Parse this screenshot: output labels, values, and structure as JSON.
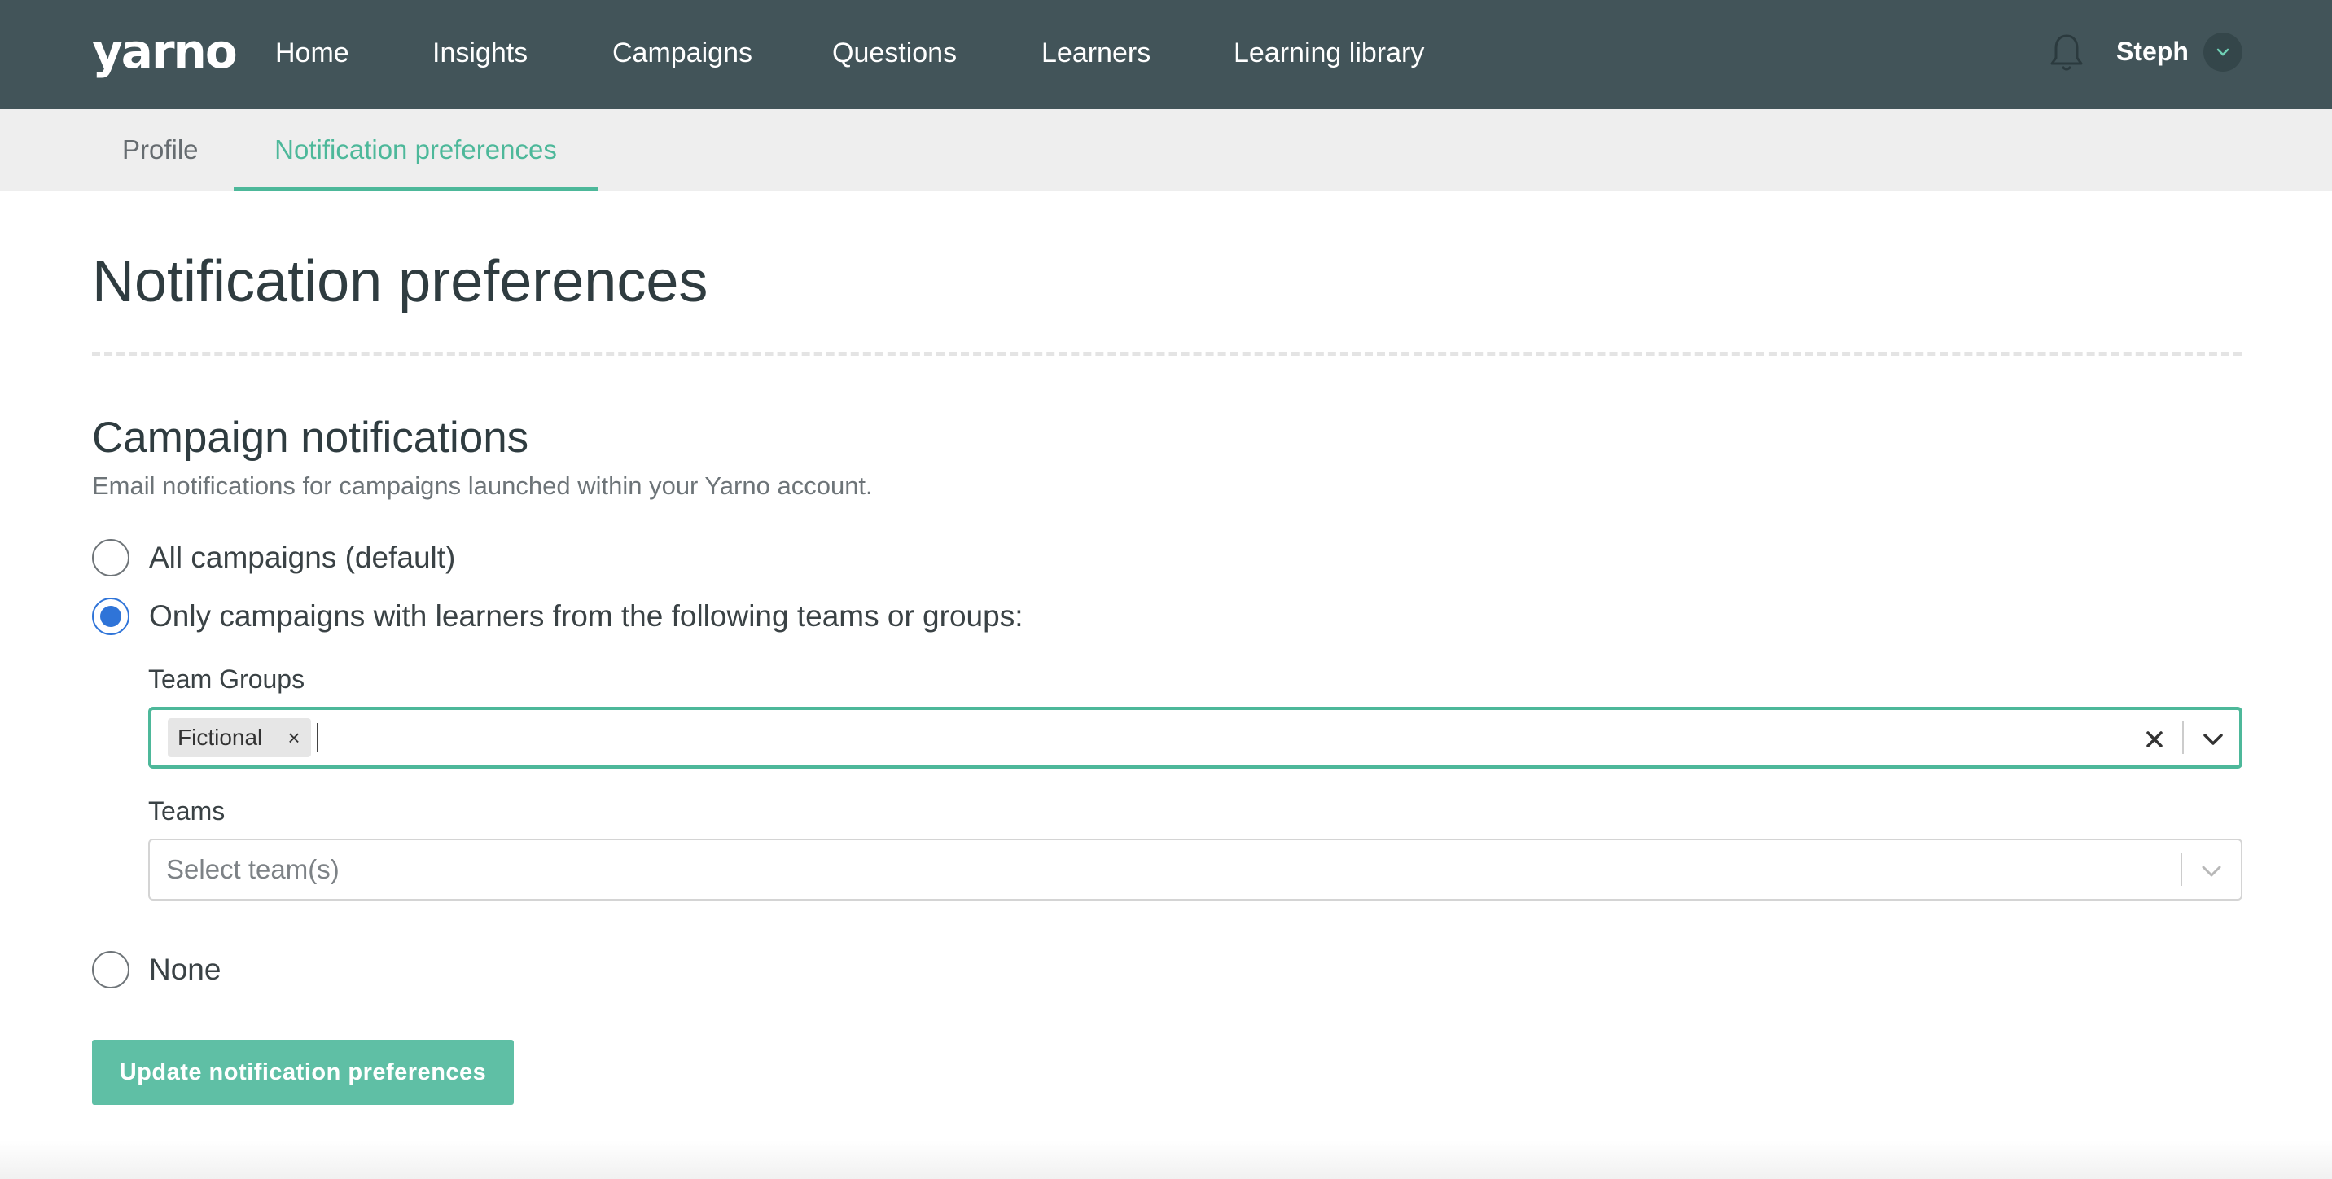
{
  "brand": {
    "logo_text": "yarno",
    "accent": "#4db89a",
    "nav_bg": "#425459"
  },
  "nav": {
    "items": [
      {
        "label": "Home"
      },
      {
        "label": "Insights"
      },
      {
        "label": "Campaigns"
      },
      {
        "label": "Questions"
      },
      {
        "label": "Learners"
      },
      {
        "label": "Learning library"
      }
    ],
    "notifications_icon": "bell-icon",
    "user_name": "Steph",
    "user_menu_icon": "chevron-down-icon"
  },
  "subnav": {
    "tabs": [
      {
        "label": "Profile",
        "active": false
      },
      {
        "label": "Notification preferences",
        "active": true
      }
    ]
  },
  "page": {
    "title": "Notification preferences"
  },
  "campaign_notifications": {
    "title": "Campaign notifications",
    "description": "Email notifications for campaigns launched within your Yarno account.",
    "options": [
      {
        "label": "All campaigns (default)",
        "checked": false
      },
      {
        "label": "Only campaigns with learners from the following teams or groups:",
        "checked": true
      },
      {
        "label": "None",
        "checked": false
      }
    ],
    "team_groups": {
      "label": "Team Groups",
      "selected": [
        {
          "label": "Fictional",
          "remove_glyph": "×"
        }
      ],
      "input_value": ""
    },
    "teams": {
      "label": "Teams",
      "placeholder": "Select team(s)"
    },
    "submit_label": "Update notification preferences"
  }
}
